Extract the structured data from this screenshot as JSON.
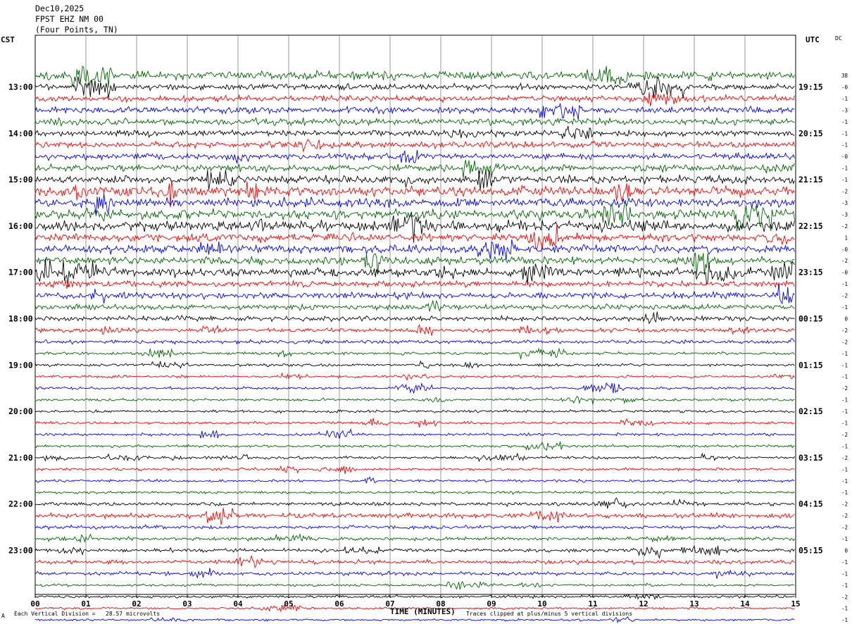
{
  "header": {
    "date": "Dec10,2025",
    "station": "FPST EHZ NM 00",
    "location": "(Four Points, TN)"
  },
  "left_zone_label": "CST",
  "right_zone_label": "UTC",
  "dc_label": "DC",
  "footer": {
    "scale_note": "Each Vertical Division =   28.57 microvolts",
    "clip_note": "Traces clipped at plus/minus 5 vertical divisions",
    "marker": "A"
  },
  "colors": {
    "black": "#000000",
    "red": "#ff0000",
    "blue": "#0000ff",
    "green": "#006400",
    "grid": "#808080"
  },
  "chart_data": {
    "type": "line",
    "title": "",
    "xlabel": "TIME (MINUTES)",
    "ylabel": "",
    "xlim": [
      0,
      15
    ],
    "x_ticks": [
      "00",
      "01",
      "02",
      "03",
      "04",
      "05",
      "06",
      "07",
      "08",
      "09",
      "10",
      "11",
      "12",
      "13",
      "14",
      "15"
    ],
    "grid": "vertical",
    "traces_per_hour": 4,
    "minutes_per_trace": 15,
    "color_cycle": [
      "black",
      "red",
      "blue",
      "green"
    ],
    "first_trace_color": "green",
    "left_hour_labels": [
      "13:00",
      "14:00",
      "15:00",
      "16:00",
      "17:00",
      "18:00",
      "19:00",
      "20:00",
      "21:00",
      "22:00",
      "23:00"
    ],
    "right_hour_labels": [
      "19:15",
      "20:15",
      "21:15",
      "22:15",
      "23:15",
      "00:15",
      "01:15",
      "02:15",
      "03:15",
      "04:15",
      "05:15"
    ],
    "dc_offsets": [
      "38",
      "-0",
      "-1",
      "-3",
      "-1",
      "-1",
      "-1",
      "-0",
      "-1",
      "-1",
      "-2",
      "-3",
      "-3",
      "-2",
      "1",
      "-0",
      "-2",
      "-0",
      "-1",
      "-2",
      "-1",
      "0",
      "-2",
      "-2",
      "-1",
      "-1",
      "-1",
      "-2",
      "-1",
      "-1",
      "-1",
      "-2",
      "-1",
      "-2",
      "-1",
      "-1",
      "-1",
      "-2",
      "-2",
      "-2",
      "-1",
      "0",
      "-1",
      "-1",
      "-1",
      "-2",
      "-1",
      "-1"
    ],
    "trace_amplitude_divisions": [
      1.4,
      1.0,
      1.0,
      1.1,
      1.1,
      1.0,
      1.0,
      1.0,
      1.2,
      1.3,
      1.6,
      1.5,
      1.6,
      1.7,
      1.3,
      1.3,
      1.3,
      1.4,
      1.0,
      1.0,
      0.9,
      0.8,
      0.7,
      0.6,
      0.5,
      0.45,
      0.45,
      0.45,
      0.45,
      0.45,
      0.45,
      0.45,
      0.45,
      0.45,
      0.45,
      0.45,
      0.45,
      0.6,
      0.8,
      0.6,
      0.6,
      0.6,
      0.7,
      0.6,
      0.45,
      0.45,
      0.4,
      0.35
    ]
  }
}
